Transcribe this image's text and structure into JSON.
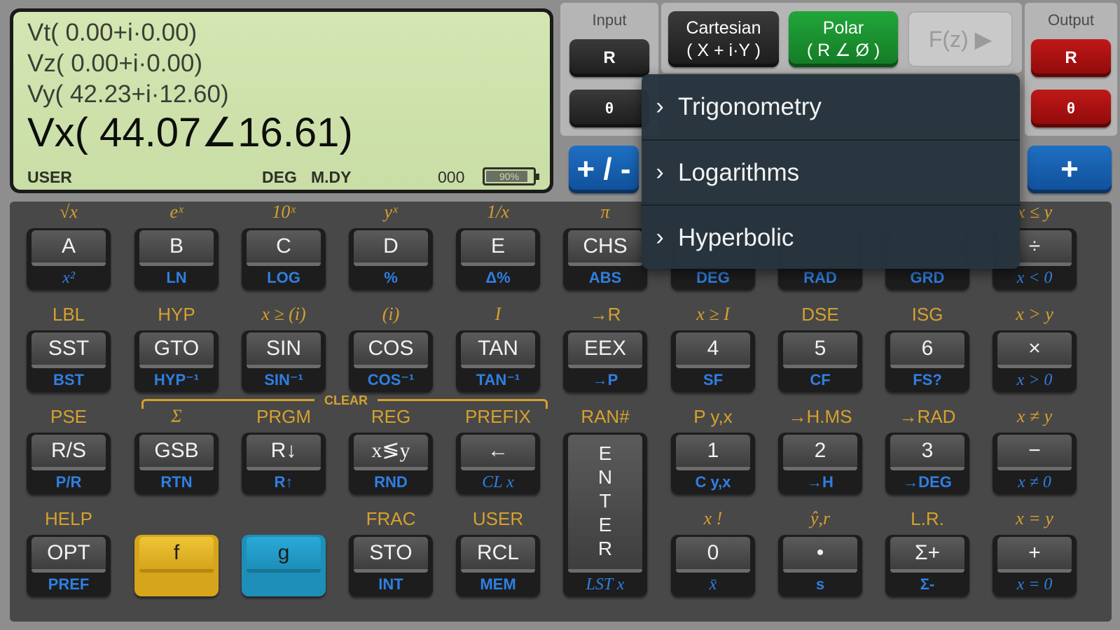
{
  "display": {
    "vt": "Vt( 0.00+i·0.00)",
    "vz": "Vz( 0.00+i·0.00)",
    "vy": "Vy( 42.23+i·12.60)",
    "vx": "Vx( 44.07∠16.61)",
    "status": {
      "user": "USER",
      "angle": "DEG",
      "date": "M.DY",
      "count": "000",
      "battery": "90%",
      "battery_level": 0.9
    }
  },
  "input_panel": {
    "title": "Input",
    "r_label": "R",
    "theta_label": "θ"
  },
  "output_panel": {
    "title": "Output",
    "r_label": "R",
    "theta_label": "θ"
  },
  "mode": {
    "cartesian_line1": "Cartesian",
    "cartesian_line2": "( X + i·Y )",
    "polar_line1": "Polar",
    "polar_line2": "( R ∠ Ø )",
    "fz_label": "F(z) ▶"
  },
  "plus_minus_label": "+ / -",
  "plus_label": "+",
  "menu": {
    "items": [
      {
        "label": "Trigonometry"
      },
      {
        "label": "Logarithms"
      },
      {
        "label": "Hyperbolic"
      }
    ]
  },
  "clear_label": "CLEAR",
  "keys": [
    {
      "top": "√x",
      "face": "A",
      "bot": "x²"
    },
    {
      "top": "eˣ",
      "face": "B",
      "bot": "LN"
    },
    {
      "top": "10ˣ",
      "face": "C",
      "bot": "LOG"
    },
    {
      "top": "yˣ",
      "face": "D",
      "bot": "%"
    },
    {
      "top": "1/x",
      "face": "E",
      "bot": "Δ%"
    },
    {
      "top": "π",
      "face": "CHS",
      "bot": "ABS"
    },
    {
      "top": "",
      "face": "",
      "bot": "DEG"
    },
    {
      "top": "",
      "face": "",
      "bot": "RAD"
    },
    {
      "top": "",
      "face": "",
      "bot": "GRD"
    },
    {
      "top": "x ≤ y",
      "face": "÷",
      "bot": "x < 0"
    },
    {
      "top": "LBL",
      "face": "SST",
      "bot": "BST"
    },
    {
      "top": "HYP",
      "face": "GTO",
      "bot": "HYP⁻¹"
    },
    {
      "top": "x ≥ (i)",
      "face": "SIN",
      "bot": "SIN⁻¹"
    },
    {
      "top": "(i)",
      "face": "COS",
      "bot": "COS⁻¹"
    },
    {
      "top": "I",
      "face": "TAN",
      "bot": "TAN⁻¹"
    },
    {
      "top": "→R",
      "face": "EEX",
      "bot": "→P"
    },
    {
      "top": "x ≥ I",
      "face": "4",
      "bot": "SF"
    },
    {
      "top": "DSE",
      "face": "5",
      "bot": "CF"
    },
    {
      "top": "ISG",
      "face": "6",
      "bot": "FS?"
    },
    {
      "top": "x > y",
      "face": "×",
      "bot": "x > 0"
    },
    {
      "top": "PSE",
      "face": "R/S",
      "bot": "P/R"
    },
    {
      "top": "Σ",
      "face": "GSB",
      "bot": "RTN"
    },
    {
      "top": "PRGM",
      "face": "R↓",
      "bot": "R↑"
    },
    {
      "top": "REG",
      "face": "x≶y",
      "bot": "RND"
    },
    {
      "top": "PREFIX",
      "face": "←",
      "bot": "CL x"
    },
    {
      "top": "RAN#",
      "face": "E\nN\nT\nE\nR",
      "bot": "LST x"
    },
    {
      "top": "P y,x",
      "face": "1",
      "bot": "C y,x"
    },
    {
      "top": "→H.MS",
      "face": "2",
      "bot": "→H"
    },
    {
      "top": "→RAD",
      "face": "3",
      "bot": "→DEG"
    },
    {
      "top": "x ≠ y",
      "face": "−",
      "bot": "x ≠ 0"
    },
    {
      "top": "HELP",
      "face": "OPT",
      "bot": "PREF"
    },
    {
      "top": "",
      "face": "f",
      "bot": ""
    },
    {
      "top": "",
      "face": "g",
      "bot": ""
    },
    {
      "top": "FRAC",
      "face": "STO",
      "bot": "INT"
    },
    {
      "top": "USER",
      "face": "RCL",
      "bot": "MEM"
    },
    {
      "top": "x !",
      "face": "0",
      "bot": "x̄"
    },
    {
      "top": "ŷ,r",
      "face": "•",
      "bot": "s"
    },
    {
      "top": "L.R.",
      "face": "Σ+",
      "bot": "Σ-"
    },
    {
      "top": "x = y",
      "face": "+",
      "bot": "x = 0"
    }
  ],
  "colors": {
    "accent_gold": "#d6a12d",
    "accent_blue": "#2f7fe2",
    "f_key": "#e2b52a",
    "g_key": "#22a0cf",
    "polar_active": "#1d9a33",
    "output_red": "#b01414"
  }
}
